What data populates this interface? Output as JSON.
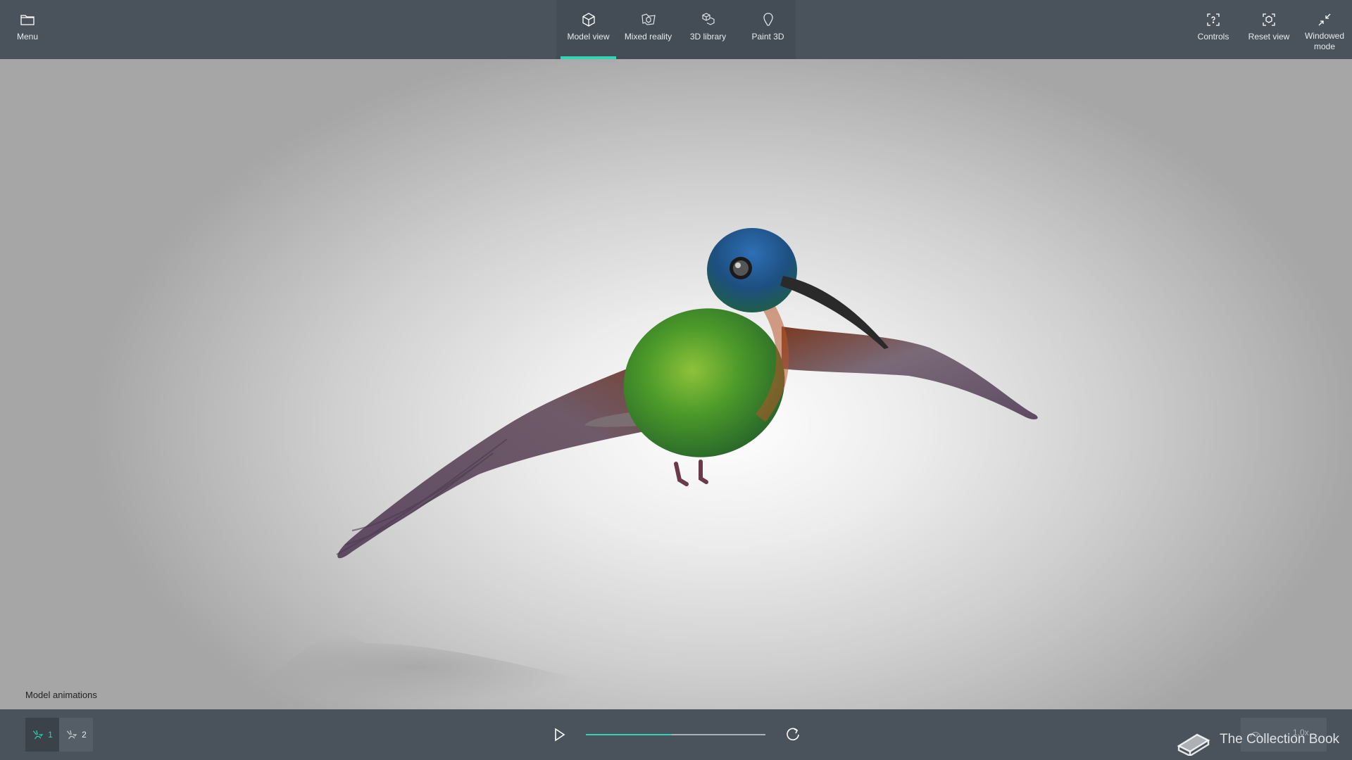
{
  "menu": {
    "label": "Menu"
  },
  "tabs": [
    {
      "label": "Model view",
      "active": true
    },
    {
      "label": "Mixed reality"
    },
    {
      "label": "3D library"
    },
    {
      "label": "Paint 3D"
    }
  ],
  "right_actions": [
    {
      "label": "Controls"
    },
    {
      "label": "Reset view"
    },
    {
      "label": "Windowed mode"
    }
  ],
  "animations": {
    "title": "Model animations",
    "items": [
      {
        "number": "1",
        "active": true
      },
      {
        "number": "2"
      }
    ],
    "progress": 0.48,
    "speed": "1.0x"
  },
  "watermark": {
    "text": "The Collection Book"
  },
  "colors": {
    "accent": "#2fd5b4",
    "bar": "#4a525c"
  }
}
